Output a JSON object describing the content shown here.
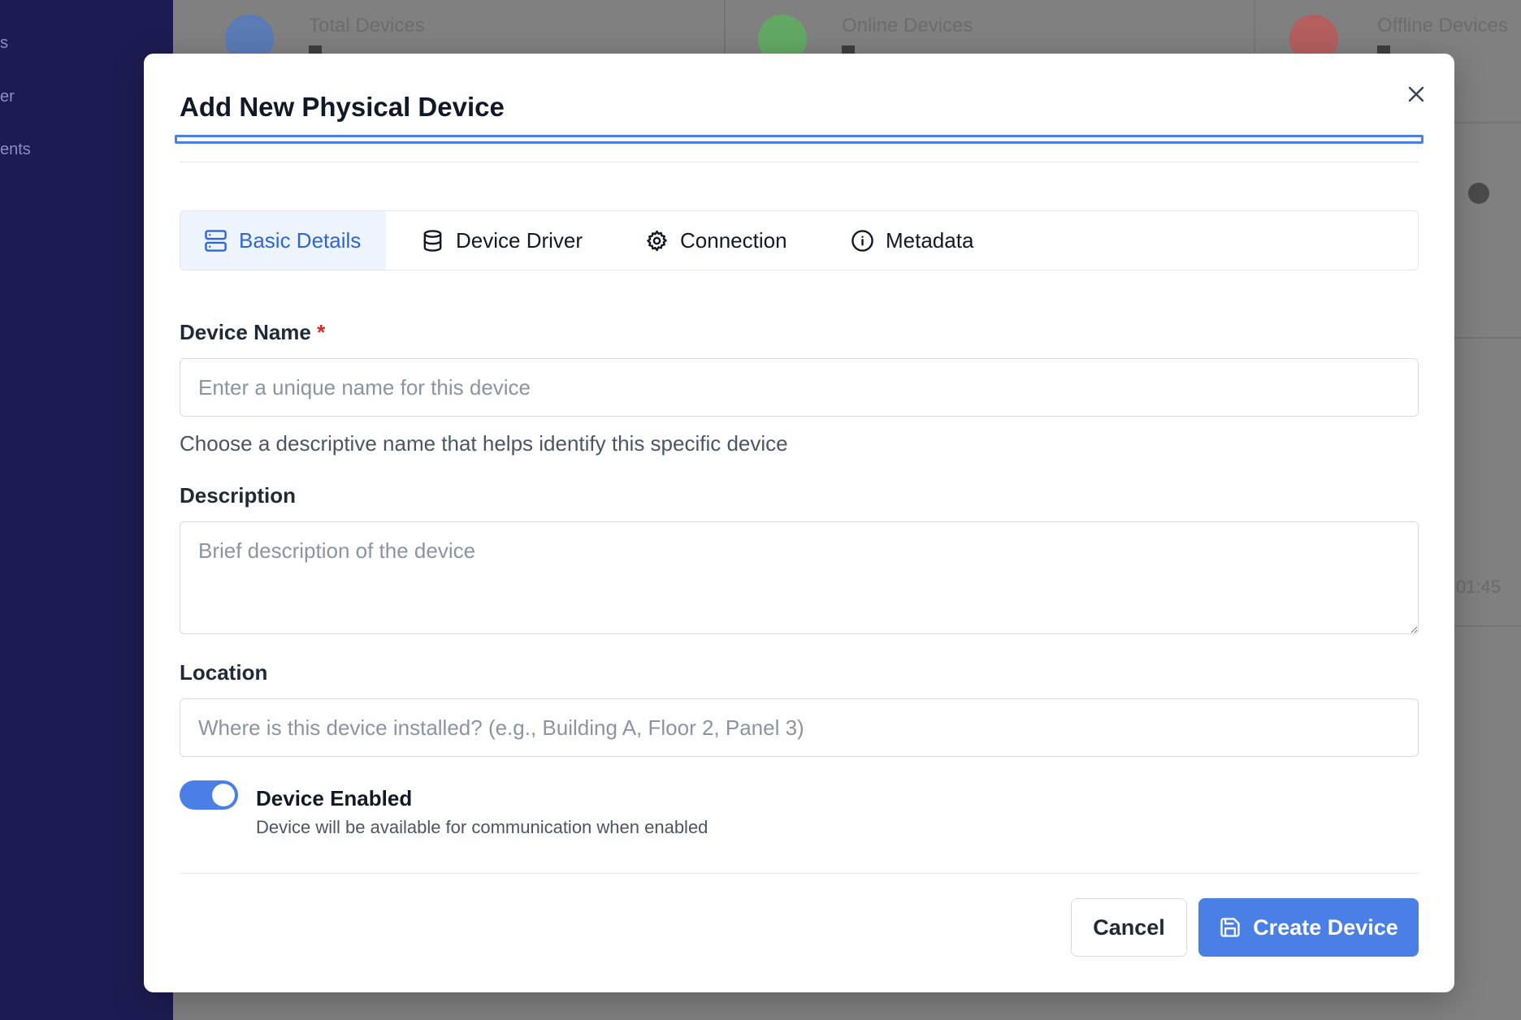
{
  "background": {
    "sidebar_items": [
      "s",
      "er",
      "ents"
    ],
    "stat_cards": [
      {
        "label": "Total Devices",
        "color": "#5a7bb6"
      },
      {
        "label": "Online Devices",
        "color": "#62a864"
      },
      {
        "label": "Offline Devices",
        "color": "#b45e5e"
      }
    ],
    "fragment": "01:45"
  },
  "modal": {
    "title": "Add New Physical Device",
    "close_label": "×",
    "tabs": [
      {
        "label": "Basic Details",
        "icon": "server-icon",
        "active": true
      },
      {
        "label": "Device Driver",
        "icon": "database-icon",
        "active": false
      },
      {
        "label": "Connection",
        "icon": "gear-icon",
        "active": false
      },
      {
        "label": "Metadata",
        "icon": "info-icon",
        "active": false
      }
    ],
    "fields": {
      "device_name": {
        "label": "Device Name",
        "required_mark": "*",
        "value": "",
        "placeholder": "Enter a unique name for this device",
        "help": "Choose a descriptive name that helps identify this specific device"
      },
      "description": {
        "label": "Description",
        "value": "",
        "placeholder": "Brief description of the device"
      },
      "location": {
        "label": "Location",
        "value": "",
        "placeholder": "Where is this device installed? (e.g., Building A, Floor 2, Panel 3)"
      }
    },
    "toggle": {
      "title": "Device Enabled",
      "description": "Device will be available for communication when enabled",
      "enabled": true
    },
    "footer": {
      "cancel_label": "Cancel",
      "create_label": "Create Device"
    }
  },
  "colors": {
    "accent": "#4a7fe6",
    "active_tab_text": "#2f66d4",
    "active_tab_bg": "#eef4fd",
    "required": "#dc2626",
    "sidebar_bg": "#1c1c52"
  }
}
